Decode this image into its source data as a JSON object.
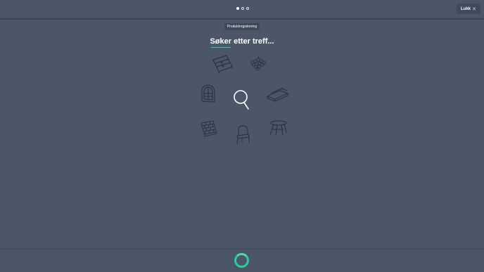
{
  "header": {
    "steps": [
      {
        "active": true
      },
      {
        "active": false
      },
      {
        "active": false
      }
    ],
    "close_label": "Lukk",
    "close_icon": "close-icon"
  },
  "main": {
    "tag_label": "Produktregistrering",
    "heading": "Søker etter treff...",
    "icons": [
      "dresser-icon",
      "grapes-icon",
      "window-icon",
      "search-icon",
      "planks-icon",
      "brick-wall-icon",
      "chair-icon",
      "stool-table-icon"
    ]
  },
  "footer": {
    "loading_indicator": "spinner-icon"
  },
  "colors": {
    "background": "#4b5769",
    "accent": "#2ecc9b",
    "line": "#2b3442"
  }
}
